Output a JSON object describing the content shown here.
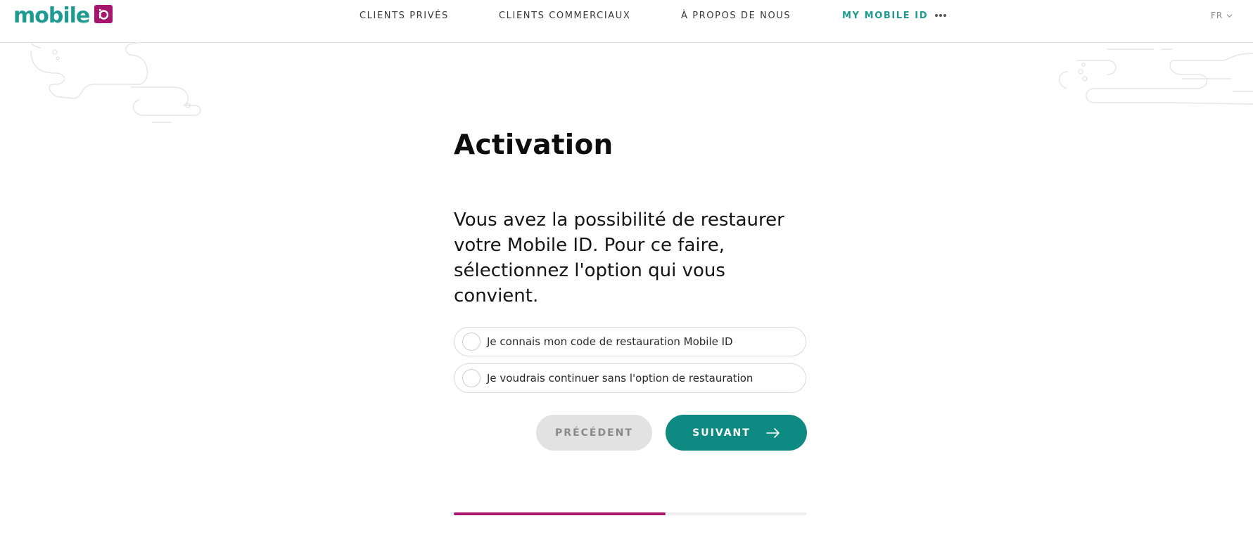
{
  "brand": {
    "logo_text": "mobile",
    "logo_badge_text": "iD",
    "accent_color": "#1f9a90",
    "brand_magenta": "#a5166c"
  },
  "header": {
    "nav": [
      {
        "label": "CLIENTS PRIVÉS",
        "active": false
      },
      {
        "label": "CLIENTS COMMERCIAUX",
        "active": false
      },
      {
        "label": "À PROPOS DE NOUS",
        "active": false
      },
      {
        "label": "MY MOBILE ID",
        "active": true
      }
    ],
    "more_icon": "more-dots-icon",
    "language": "FR",
    "language_icon": "chevron-down-icon"
  },
  "main": {
    "title": "Activation",
    "lead": "Vous avez la possibilité de restaurer votre Mobile ID. Pour ce faire, sélectionnez l'option qui vous convient.",
    "options": [
      {
        "label": "Je connais mon code de restauration Mobile ID",
        "selected": false
      },
      {
        "label": "Je voudrais continuer sans l'option de restauration",
        "selected": false
      }
    ],
    "buttons": {
      "previous_label": "PRÉCÉDENT",
      "next_label": "SUIVANT",
      "next_icon": "arrow-right-icon"
    },
    "progress": {
      "fraction": 0.6,
      "fill_color": "#a5166c"
    }
  }
}
